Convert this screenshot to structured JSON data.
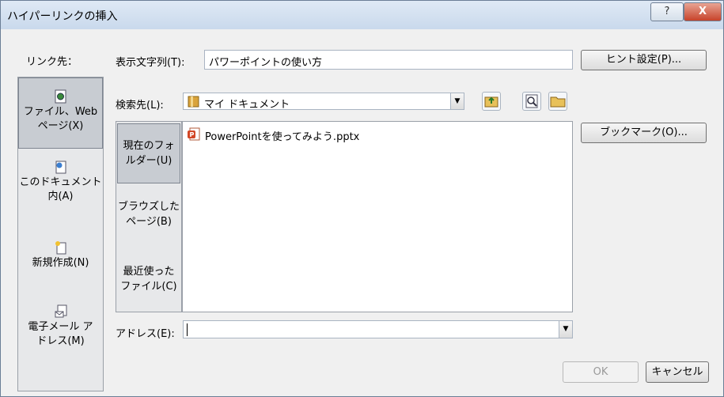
{
  "window": {
    "title": "ハイパーリンクの挿入",
    "help_icon": "?",
    "close_icon": "X"
  },
  "link_to_label": "リンク先：",
  "sidebar": {
    "items": [
      {
        "line1": "ファイル、Web",
        "line2": "ページ(X)",
        "icon": "file-web-icon"
      },
      {
        "line1": "このドキュメント",
        "line2": "内(A)",
        "icon": "document-icon"
      },
      {
        "line1": "新規作成(N)",
        "line2": "",
        "icon": "new-document-icon"
      },
      {
        "line1": "電子メール ア",
        "line2": "ドレス(M)",
        "icon": "email-icon"
      }
    ]
  },
  "display_text": {
    "label": "表示文字列(T):",
    "value": "パワーポイントの使い方"
  },
  "screentip_button": "ヒント設定(P)...",
  "look_in": {
    "label": "検索先(L):",
    "value": "マイ ドキュメント"
  },
  "bookmark_button": "ブックマーク(O)...",
  "subnav": {
    "items": [
      {
        "line1": "現在のフォ",
        "line2": "ルダー(U)"
      },
      {
        "line1": "ブラウズした",
        "line2": "ページ(B)"
      },
      {
        "line1": "最近使った",
        "line2": "ファイル(C)"
      }
    ]
  },
  "files": [
    {
      "name": "PowerPointを使ってみよう.pptx",
      "icon": "pptx-icon"
    }
  ],
  "address": {
    "label": "アドレス(E):",
    "value": ""
  },
  "ok_button": "OK",
  "cancel_button": "キャンセル",
  "colors": {
    "accent": "#c7432b",
    "title_bg": "#dfe9f5"
  }
}
